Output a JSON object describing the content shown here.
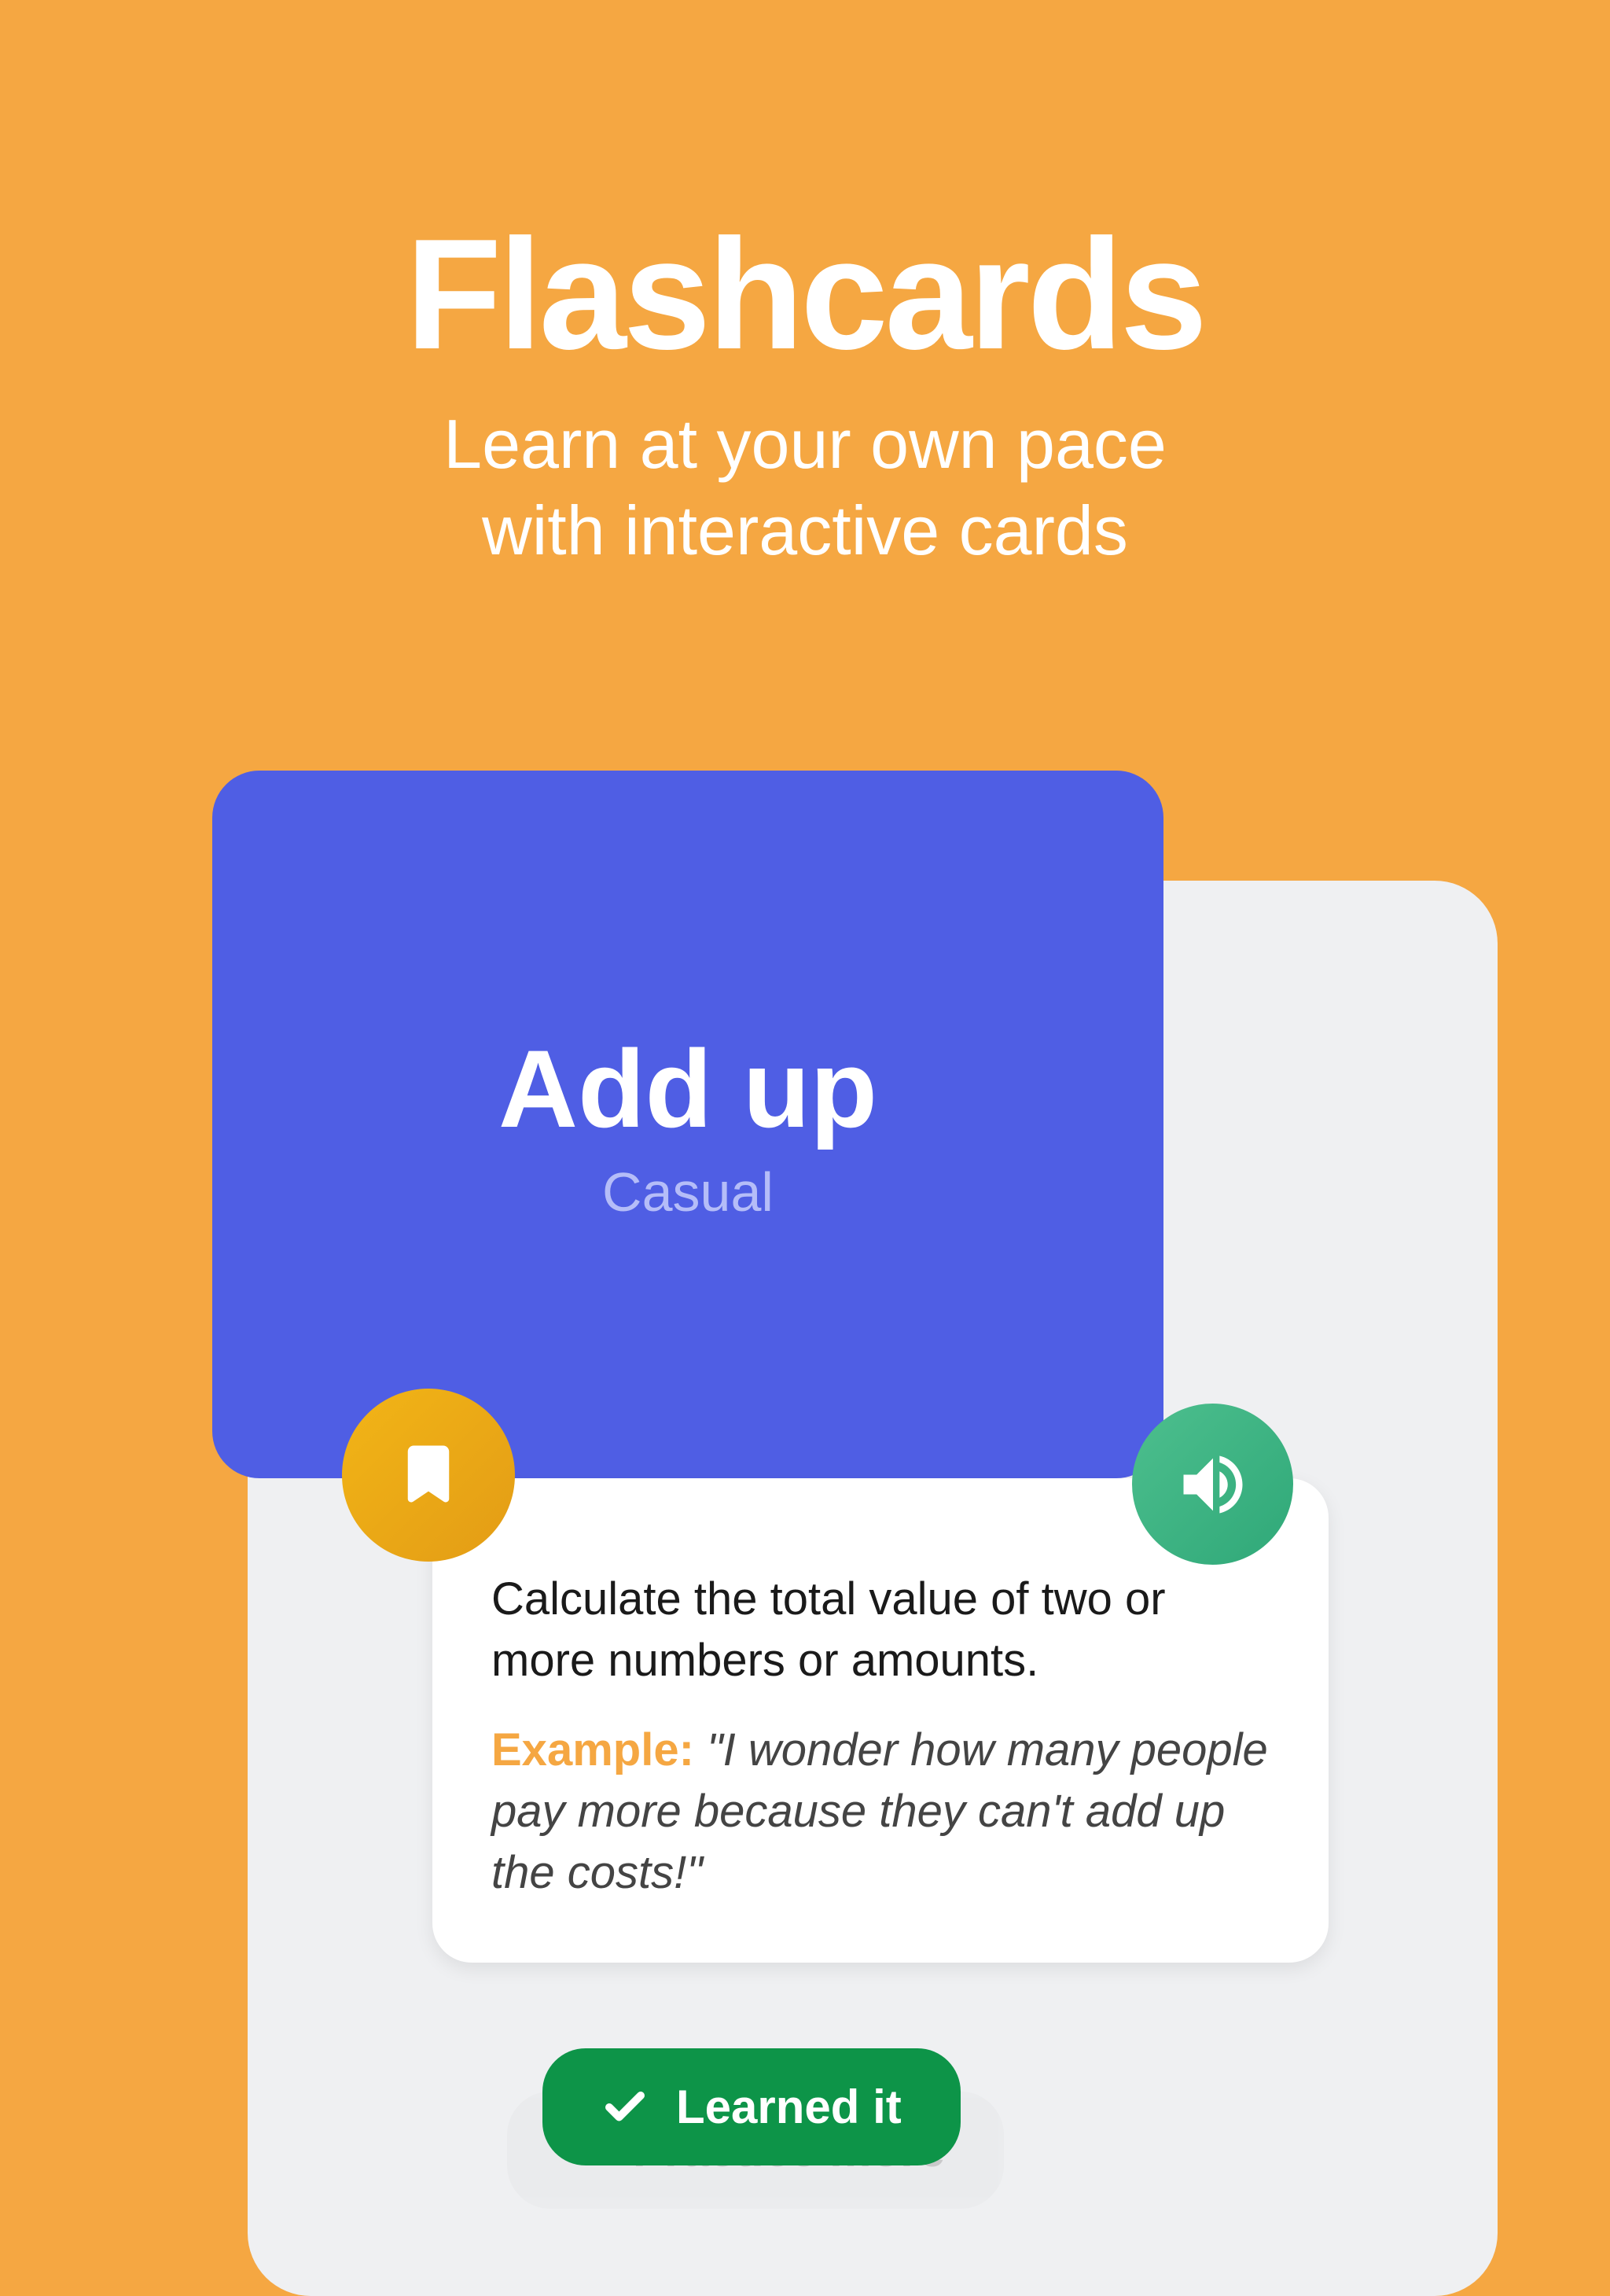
{
  "header": {
    "title": "Flashcards",
    "subtitle_line1": "Learn at your own pace",
    "subtitle_line2": "with interactive cards"
  },
  "card": {
    "term": "Add up",
    "tag": "Casual",
    "definition": "Calculate the total value of two or more numbers or amounts.",
    "example_label": "Example:",
    "example_text": "\"I wonder how many people pay more because they can't add up the costs!\""
  },
  "buttons": {
    "learned": "Learned it",
    "practice": "Practice more"
  }
}
